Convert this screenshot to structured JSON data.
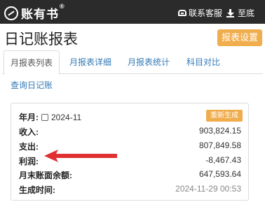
{
  "header": {
    "logo_text": "账有书",
    "logo_mark": "®",
    "contact_label": "联系客服",
    "bottom_label": "至底"
  },
  "page": {
    "title": "日记账报表",
    "report_settings_label": "报表设置"
  },
  "tabs": [
    {
      "label": "月报表列表"
    },
    {
      "label": "月报表详细"
    },
    {
      "label": "月报表统计"
    },
    {
      "label": "科目对比"
    }
  ],
  "subnav": {
    "label": "查询日记账"
  },
  "report": {
    "year_month_label": "年月:",
    "year_month_value": "2024-11",
    "regenerate_label": "重新生成",
    "rows": [
      {
        "label": "收入:",
        "value": "903,824.15"
      },
      {
        "label": "支出:",
        "value": "807,849.58"
      },
      {
        "label": "利润:",
        "value": "-8,467.43"
      },
      {
        "label": "月末账面余额:",
        "value": "647,593.64"
      },
      {
        "label": "生成时间:",
        "value": "2024-11-29 00:53"
      }
    ]
  },
  "colors": {
    "topbar": "#2b2b2b",
    "accent_orange": "#f0ad4e",
    "link_blue": "#337ab7",
    "arrow_red": "#e03030"
  }
}
